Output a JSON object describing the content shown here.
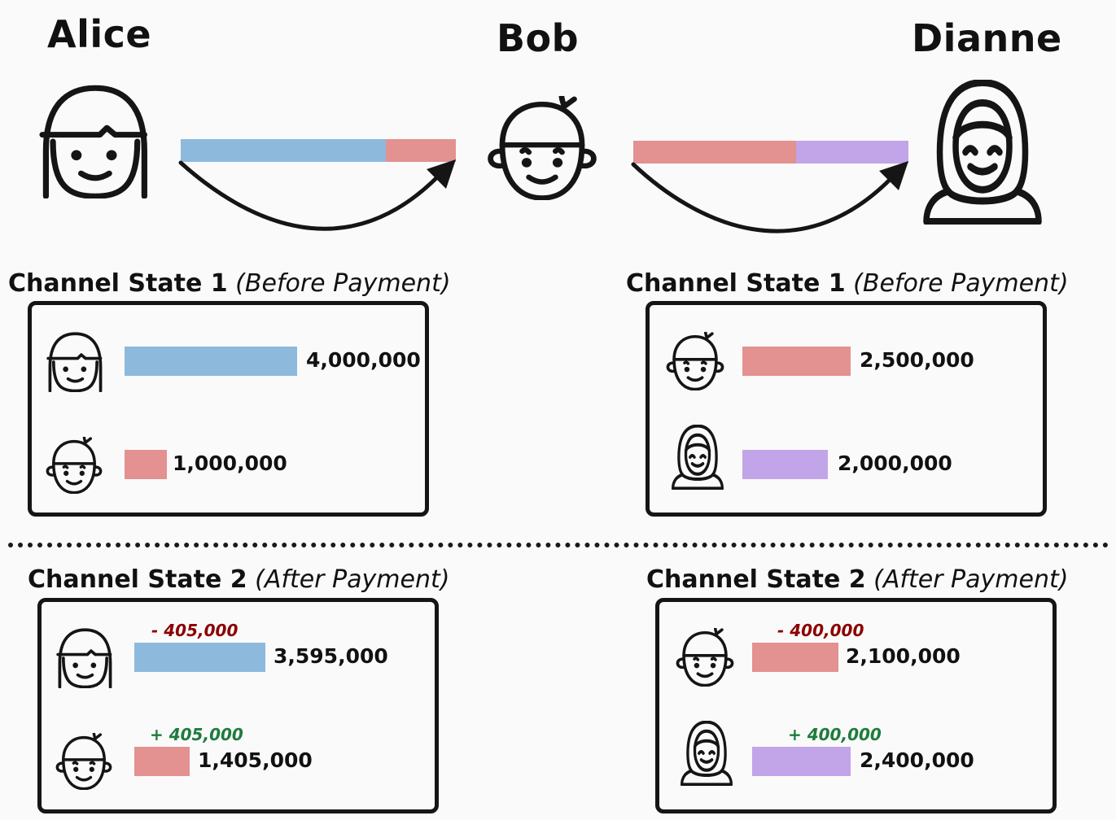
{
  "colors": {
    "alice": "#8db9dc",
    "bob": "#e39191",
    "dianne": "#c1a5e8",
    "decrease": "#8b0000",
    "increase": "#1e7b3c",
    "stroke": "#151515"
  },
  "participants": {
    "alice": {
      "name": "Alice",
      "icon": "alice-face-icon"
    },
    "bob": {
      "name": "Bob",
      "icon": "bob-face-icon"
    },
    "dianne": {
      "name": "Dianne",
      "icon": "dianne-hijab-face-icon"
    }
  },
  "top_channels": [
    {
      "from": "alice",
      "to": "bob",
      "segments": [
        {
          "owner": "alice",
          "share": 0.8
        },
        {
          "owner": "bob",
          "share": 0.2
        }
      ]
    },
    {
      "from": "bob",
      "to": "dianne",
      "segments": [
        {
          "owner": "bob",
          "share": 0.556
        },
        {
          "owner": "dianne",
          "share": 0.444
        }
      ]
    }
  ],
  "states": {
    "left_before": {
      "title": "Channel State 1",
      "subtitle": "(Before Payment)",
      "rows": [
        {
          "party": "alice",
          "value": "4,000,000",
          "amount": 4000000
        },
        {
          "party": "bob",
          "value": "1,000,000",
          "amount": 1000000
        }
      ]
    },
    "right_before": {
      "title": "Channel State 1",
      "subtitle": "(Before Payment)",
      "rows": [
        {
          "party": "bob",
          "value": "2,500,000",
          "amount": 2500000
        },
        {
          "party": "dianne",
          "value": "2,000,000",
          "amount": 2000000
        }
      ]
    },
    "left_after": {
      "title": "Channel State 2",
      "subtitle": "(After Payment)",
      "rows": [
        {
          "party": "alice",
          "value": "3,595,000",
          "amount": 3595000,
          "delta": "- 405,000"
        },
        {
          "party": "bob",
          "value": "1,405,000",
          "amount": 1405000,
          "delta": "+ 405,000"
        }
      ]
    },
    "right_after": {
      "title": "Channel State 2",
      "subtitle": "(After Payment)",
      "rows": [
        {
          "party": "bob",
          "value": "2,100,000",
          "amount": 2100000,
          "delta": "- 400,000"
        },
        {
          "party": "dianne",
          "value": "2,400,000",
          "amount": 2400000,
          "delta": "+ 400,000"
        }
      ]
    }
  }
}
